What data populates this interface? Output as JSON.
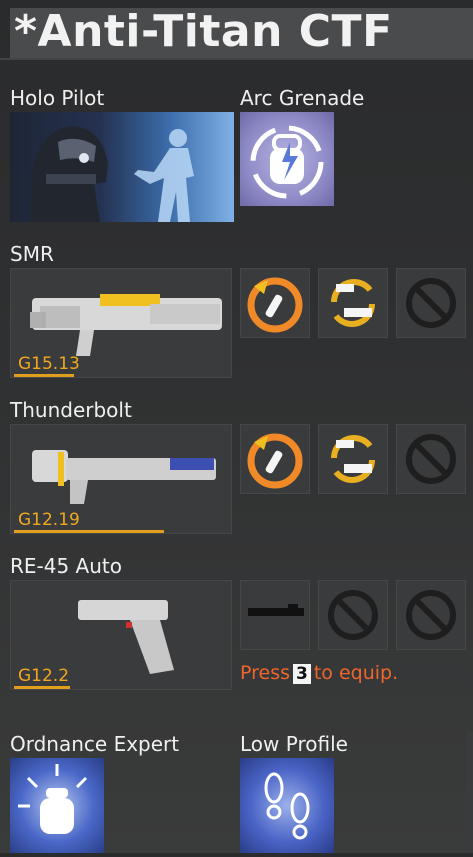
{
  "loadout": {
    "title": "*Anti-Titan CTF"
  },
  "pilot": {
    "tactical_label": "Holo Pilot",
    "ordnance_label": "Arc Grenade"
  },
  "primary": {
    "name": "SMR",
    "code": "G15.13"
  },
  "secondary": {
    "name": "Thunderbolt",
    "code": "G12.19"
  },
  "sidearm": {
    "name": "RE-45 Auto",
    "code": "G12.2",
    "hint_before": "Press",
    "hint_key": "3",
    "hint_after": "to equip."
  },
  "kits": {
    "kit1_label": "Ordnance Expert",
    "kit2_label": "Low Profile"
  },
  "colors": {
    "accent_orange": "#f0652b",
    "gen_gold": "#e0a01e",
    "tile_bg": "#3a3b3c"
  },
  "icons": [
    "fast-reload-icon",
    "weapon-swap-icon",
    "empty-slot-icon",
    "extended-mag-icon",
    "grenade-icon",
    "footsteps-icon"
  ]
}
